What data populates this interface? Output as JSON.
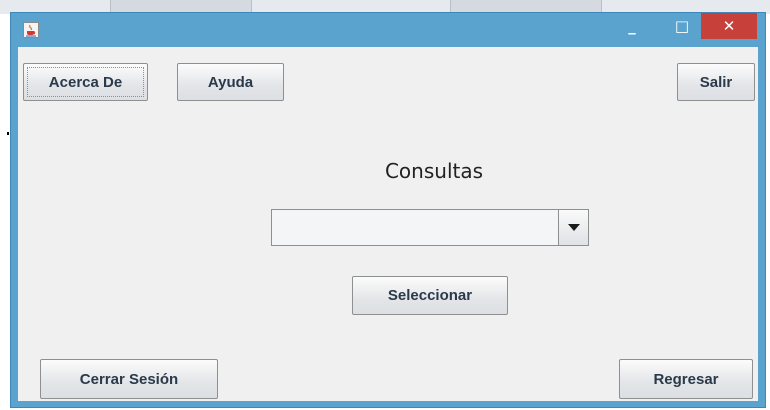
{
  "window": {
    "icon": "java-cup-icon",
    "controls": {
      "minimize": "_",
      "maximize": "□",
      "close": "✕"
    }
  },
  "toolbar": {
    "about_label": "Acerca De",
    "help_label": "Ayuda",
    "exit_label": "Salir"
  },
  "main": {
    "title": "Consultas",
    "query_select": {
      "value": "",
      "arrow_icon": "triangle-down-icon"
    },
    "select_button_label": "Seleccionar"
  },
  "footer": {
    "logout_label": "Cerrar Sesión",
    "back_label": "Regresar"
  },
  "colors": {
    "titlebar": "#5aa3cf",
    "close_button": "#c7403a",
    "client_background": "#f0f0f0",
    "button_text": "#2b3a4a"
  }
}
